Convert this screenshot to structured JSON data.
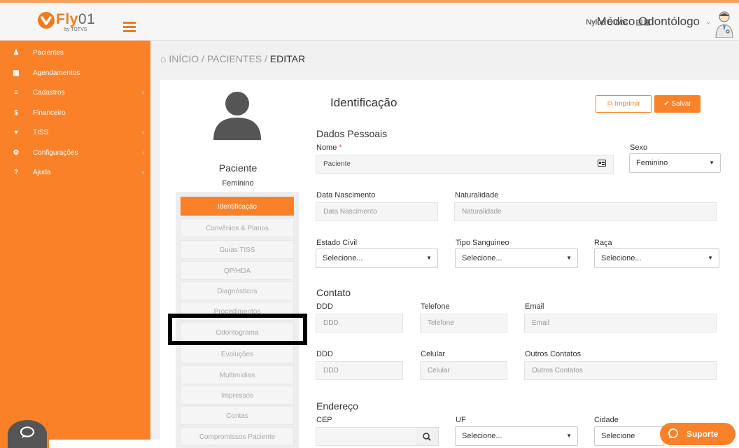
{
  "brand": {
    "logo_text": "Fly",
    "logo_suffix": "01",
    "logo_sub": "by TOTVS",
    "color": "#fa8128"
  },
  "sidebar": {
    "items": [
      {
        "label": "Pacientes",
        "icon": "users-icon",
        "has_submenu": false
      },
      {
        "label": "Agendamentos",
        "icon": "calendar-icon",
        "has_submenu": false
      },
      {
        "label": "Cadastros",
        "icon": "list-icon",
        "has_submenu": true
      },
      {
        "label": "Financeiro",
        "icon": "dollar-icon",
        "has_submenu": false
      },
      {
        "label": "TISS",
        "icon": "heartbeat-icon",
        "has_submenu": true
      },
      {
        "label": "Configurações",
        "icon": "gear-icon",
        "has_submenu": true
      },
      {
        "label": "Ajuda",
        "icon": "question-icon",
        "has_submenu": true
      }
    ]
  },
  "header": {
    "user_name": "Nylce Duval",
    "role": "Médico Odontólogo"
  },
  "breadcrumb": {
    "home": "INÍCIO",
    "sep1": "/",
    "section": "PACIENTES",
    "sep2": "/",
    "current": "EDITAR"
  },
  "patient": {
    "name": "Paciente",
    "sex": "Feminino"
  },
  "tabs": [
    {
      "label": "Identificação",
      "active": true
    },
    {
      "label": "Convênios & Planos",
      "active": false
    },
    {
      "label": "Guias TISS",
      "active": false
    },
    {
      "label": "QP/HDA",
      "active": false
    },
    {
      "label": "Diagnósticos",
      "active": false
    },
    {
      "label": "Procedimentos",
      "active": false
    },
    {
      "label": "Odontograma",
      "active": false
    },
    {
      "label": "Evoluções",
      "active": false
    },
    {
      "label": "Multimídias",
      "active": false
    },
    {
      "label": "Impressos",
      "active": false
    },
    {
      "label": "Contas",
      "active": false
    },
    {
      "label": "Compromissos Paciente",
      "active": false
    }
  ],
  "form": {
    "title": "Identificação",
    "print_label": "Imprimir",
    "save_label": "Salvar",
    "dados_pessoais": {
      "title": "Dados Pessoais",
      "nome_label": "Nome",
      "nome_required": "*",
      "nome_value": "Paciente",
      "sexo_label": "Sexo",
      "sexo_value": "Feminino",
      "nascimento_label": "Data Nascimento",
      "nascimento_placeholder": "Data Nascimento",
      "naturalidade_label": "Naturalidade",
      "naturalidade_placeholder": "Naturalidade",
      "estado_civil_label": "Estado Civil",
      "estado_civil_value": "Selecione...",
      "tipo_sanguineo_label": "Tipo Sanguineo",
      "tipo_sanguineo_value": "Selecione...",
      "raca_label": "Raça",
      "raca_value": "Selecione..."
    },
    "contato": {
      "title": "Contato",
      "ddd_label": "DDD",
      "ddd_placeholder": "DDD",
      "telefone_label": "Telefone",
      "telefone_placeholder": "Telefone",
      "email_label": "Email",
      "email_placeholder": "Email",
      "ddd2_label": "DDD",
      "ddd2_placeholder": "DDD",
      "celular_label": "Celular",
      "celular_placeholder": "Celular",
      "outros_label": "Outros Contatos",
      "outros_placeholder": "Outros Contatos"
    },
    "endereco": {
      "title": "Endereço",
      "cep_label": "CEP",
      "uf_label": "UF",
      "uf_value": "Selecione...",
      "cidade_label": "Cidade",
      "cidade_value": "Selecione"
    }
  },
  "support": {
    "label": "Suporte"
  }
}
